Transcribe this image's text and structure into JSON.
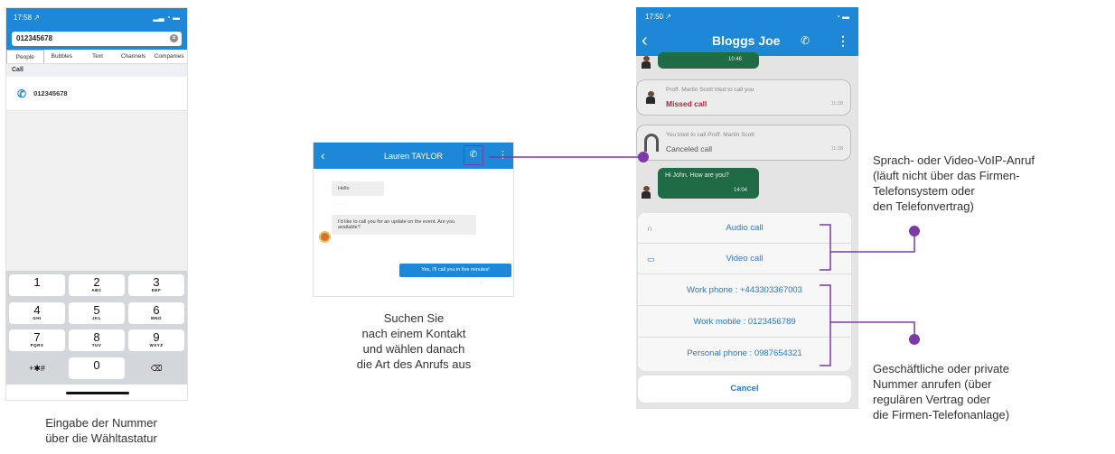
{
  "colors": {
    "brand_blue": "#1e88d6",
    "accent_purple": "#7b3aa6",
    "chat_green": "#1f6b46",
    "missed_red": "#c0392b"
  },
  "phone1": {
    "status_time": "17:58 ↗",
    "search_value": "012345678",
    "tabs": [
      "People",
      "Bubbles",
      "Text",
      "Channels",
      "Companies"
    ],
    "section": "Call",
    "call_number": "012345678",
    "keys": [
      {
        "digit": "1",
        "letters": ""
      },
      {
        "digit": "2",
        "letters": "ABC"
      },
      {
        "digit": "3",
        "letters": "DEF"
      },
      {
        "digit": "4",
        "letters": "GHI"
      },
      {
        "digit": "5",
        "letters": "JKL"
      },
      {
        "digit": "6",
        "letters": "MNO"
      },
      {
        "digit": "7",
        "letters": "PQRS"
      },
      {
        "digit": "8",
        "letters": "TUV"
      },
      {
        "digit": "9",
        "letters": "WXYZ"
      },
      {
        "digit": "+✱#",
        "letters": ""
      },
      {
        "digit": "0",
        "letters": ""
      },
      {
        "digit": "⌫",
        "letters": ""
      }
    ]
  },
  "phone2": {
    "title": "Lauren TAYLOR",
    "msg1": "Hello",
    "msg2": "I'd like to call you for an update on the event. Are you available?",
    "reply": "Yes, I'll call you in five minutes!"
  },
  "phone3": {
    "status_time": "17:50 ↗",
    "title": "Bloggs Joe",
    "top_time": "10:46",
    "missed_line1": "Proff. Martin Scott tried to call you",
    "missed_line2": "Missed call",
    "missed_time": "11:28",
    "cancel_line1": "You tried to call Proff. Martin Scott",
    "cancel_line2": "Canceled call",
    "cancel_time": "11:28",
    "green_msg": "Hi John. How are you?",
    "green_time": "14:04",
    "audio_call": "Audio call",
    "video_call": "Video call",
    "work_phone": "Work phone : +443303367003",
    "work_mobile": "Work mobile : 0123456789",
    "personal_phone": "Personal phone : 0987654321",
    "cancel": "Cancel"
  },
  "captions": {
    "left_1": "Eingabe der Nummer",
    "left_2": "über die Wähltastatur",
    "mid_1": "Suchen Sie",
    "mid_2": "nach einem Kontakt",
    "mid_3": "und wählen danach",
    "mid_4": "die Art des Anrufs aus",
    "voip_1": "Sprach- oder Video-VoIP-Anruf",
    "voip_2": "(läuft nicht über das Firmen-",
    "voip_3": "Telefonsystem oder",
    "voip_4": "den Telefonvertrag)",
    "biz_1": "Geschäftliche oder private",
    "biz_2": "Nummer anrufen (über",
    "biz_3": "regulären Vertrag oder",
    "biz_4": "die Firmen-Telefonanlage)"
  }
}
